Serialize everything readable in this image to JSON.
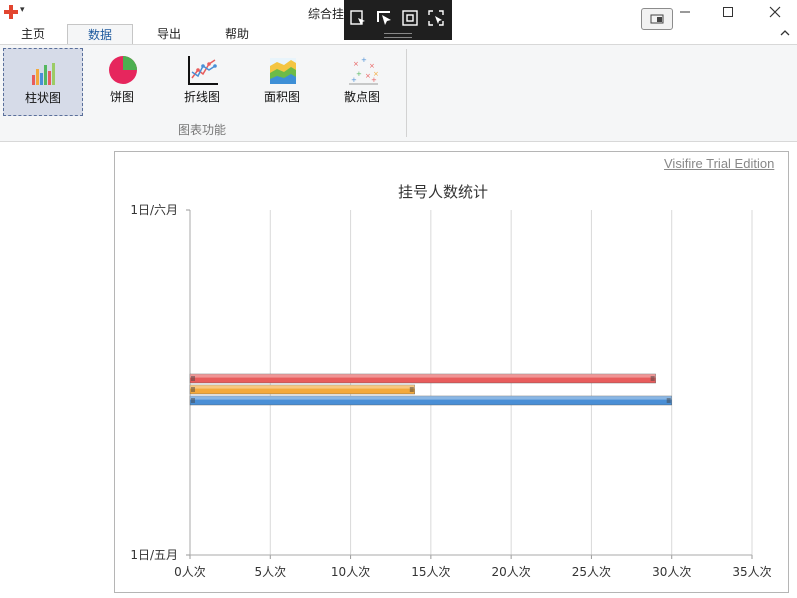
{
  "window": {
    "title": "综合挂"
  },
  "ribbon": {
    "tabs": [
      {
        "label": "主页",
        "active": false
      },
      {
        "label": "数据",
        "active": true
      },
      {
        "label": "导出",
        "active": false
      },
      {
        "label": "帮助",
        "active": false
      }
    ],
    "buttons": [
      {
        "label": "柱状图",
        "icon": "bar-chart-icon",
        "selected": true
      },
      {
        "label": "饼图",
        "icon": "pie-chart-icon",
        "selected": false
      },
      {
        "label": "折线图",
        "icon": "line-chart-icon",
        "selected": false
      },
      {
        "label": "面积图",
        "icon": "area-chart-icon",
        "selected": false
      },
      {
        "label": "散点图",
        "icon": "scatter-chart-icon",
        "selected": false
      }
    ],
    "group_label": "图表功能"
  },
  "watermark": "Visifire Trial Edition",
  "chart_data": {
    "type": "bar",
    "orientation": "horizontal",
    "title": "挂号人数统计",
    "categories": [
      "1日/五月",
      "1日/六月"
    ],
    "series": [
      {
        "color": "#e85c5c",
        "values": [
          null,
          29
        ]
      },
      {
        "color": "#f4a93b",
        "values": [
          null,
          14
        ]
      },
      {
        "color": "#4a8fd6",
        "values": [
          null,
          30
        ]
      }
    ],
    "xlim": [
      0,
      35
    ],
    "x_ticks": [
      0,
      5,
      10,
      15,
      20,
      25,
      30,
      35
    ],
    "x_tick_labels": [
      "0人次",
      "5人次",
      "10人次",
      "15人次",
      "20人次",
      "25人次",
      "30人次",
      "35人次"
    ],
    "bar_date_fraction": 0.5,
    "grid": true
  }
}
